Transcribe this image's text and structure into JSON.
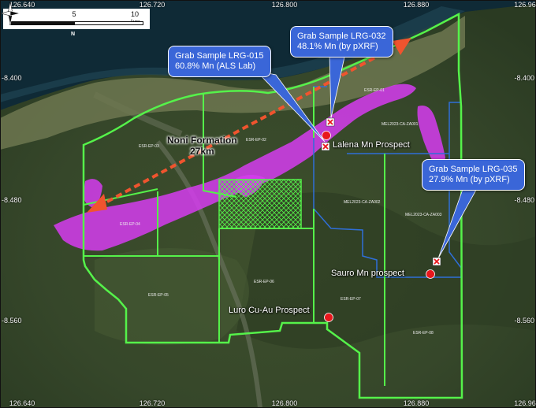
{
  "axes": {
    "top_ticks": [
      "126.640",
      "126.720",
      "126.800",
      "126.880",
      "126.96"
    ],
    "bottom_ticks": [
      "126.640",
      "126.720",
      "126.800",
      "126.880",
      "126.96"
    ],
    "left_ticks": [
      "-8.400",
      "-8.480",
      "-8.560"
    ],
    "right_ticks": [
      "-8.400",
      "-8.480",
      "-8.560"
    ]
  },
  "scale_bar": {
    "labels": [
      "0",
      "5",
      "10 km"
    ]
  },
  "north_arrow": {
    "icon": "compass-rose-icon",
    "label": "N"
  },
  "callouts": {
    "lrg015": {
      "line1": "Grab Sample LRG-015",
      "line2": "60.8% Mn (ALS Lab)"
    },
    "lrg032": {
      "line1": "Grab Sample LRG-032",
      "line2": "48.1% Mn (by pXRF)"
    },
    "lrg035": {
      "line1": "Grab Sample LRG-035",
      "line2": "27.9% Mn (by pXRF)"
    }
  },
  "prospects": {
    "lalena": "Lalena Mn Prospect",
    "sauro": "Sauro Mn prospect",
    "luro": "Luro Cu-Au Prospect"
  },
  "formation": {
    "name": "Noni Formation",
    "length": "27km"
  },
  "tenements": {
    "t1": "ESR-EP-02",
    "t2": "ESR-EP-03",
    "t3": "ESR-EP-01",
    "t4": "ESR-EP-04",
    "t5": "ESR-EP-06",
    "t6": "ESR-EP-05",
    "t7": "ESR-EP-07",
    "t8": "ESR-EP-08",
    "t9": "MEL2023-CA-ZA001",
    "t10": "MEL2023-CA-ZA002",
    "t11": "MEL2023-CA-ZA003"
  },
  "colors": {
    "boundary": "#55f24a",
    "blue_boundary": "#2f6fd8",
    "mn_zone": "#d63cf0",
    "marker": "#e8171c",
    "arrow": "#f0542e",
    "callout": "#3a66d8"
  }
}
